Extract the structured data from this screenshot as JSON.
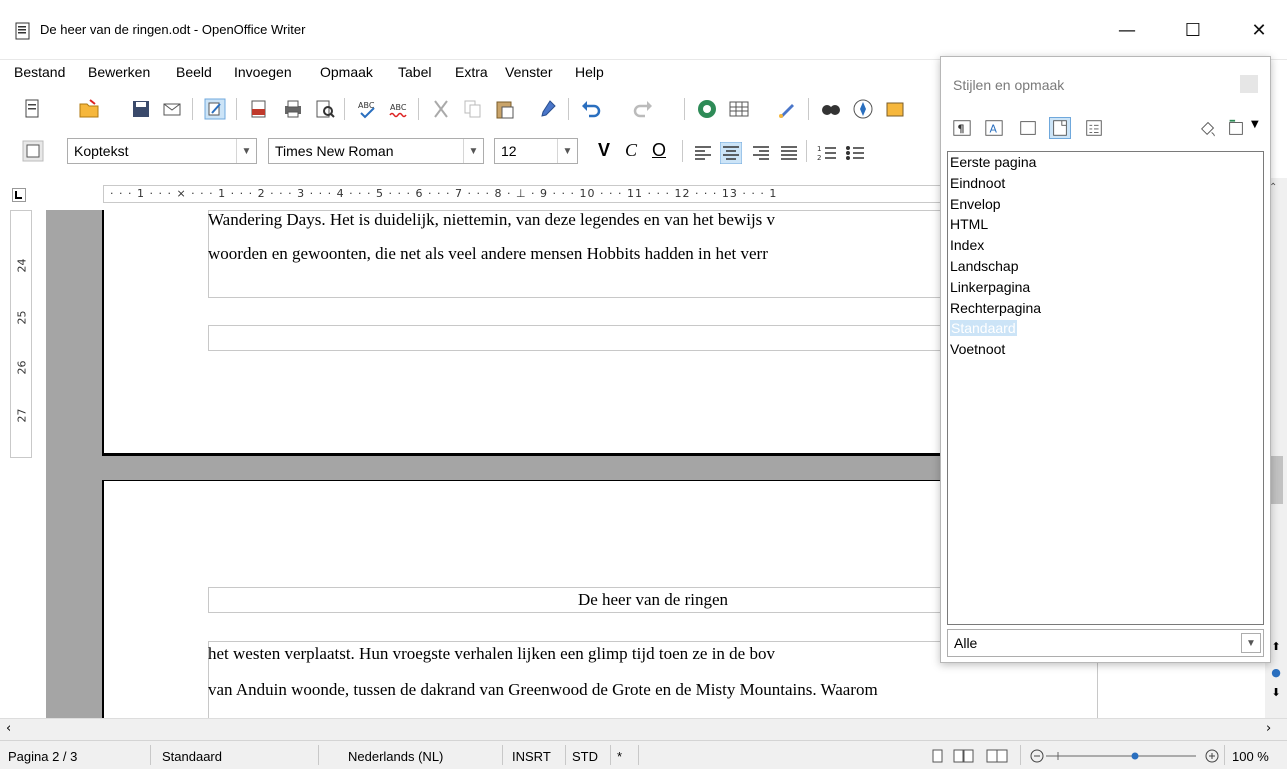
{
  "window": {
    "title": "De heer van de ringen.odt - OpenOffice Writer"
  },
  "menu": [
    "Bestand",
    "Bewerken",
    "Beeld",
    "Invoegen",
    "Opmaak",
    "Tabel",
    "Extra",
    "Venster",
    "Help"
  ],
  "formatting": {
    "style": "Koptekst",
    "font": "Times New Roman",
    "size": "12",
    "bold_glyph": "V",
    "italic_glyph": "C",
    "underline_glyph": "O"
  },
  "ruler": {
    "top": "· · · 1 · · · ⨯ · · · 1 · · · 2 · · · 3 · · · 4 · · · 5 · · · 6 · · · 7 · · · 8 · ⊥ · 9 · · · 10 · · · 11 · · · 12 · · · 13 · · · 1",
    "left": [
      "24",
      "25",
      "26",
      "27"
    ]
  },
  "document": {
    "line1": "Wandering Days. Het is duidelijk, niettemin, van deze legendes en van het bewijs v",
    "line2": "woorden en gewoonten, die net als veel andere mensen Hobbits hadden in het verr",
    "header": "De heer van de ringen",
    "line3": "het westen verplaatst. Hun vroegste verhalen lijken een glimp tijd toen ze in de bov",
    "line4": "van Anduin woonde, tussen de dakrand van Greenwood de Grote en de Misty Mountains. Waarom"
  },
  "styles_panel": {
    "title": "Stijlen en opmaak",
    "items": [
      "Eerste pagina",
      "Eindnoot",
      "Envelop",
      "HTML",
      "Index",
      "Landschap",
      "Linkerpagina",
      "Rechterpagina",
      "Standaard",
      "Voetnoot"
    ],
    "selected": "Standaard",
    "filter": "Alle"
  },
  "status": {
    "page": "Pagina 2 / 3",
    "style": "Standaard",
    "language": "Nederlands (NL)",
    "insert": "INSRT",
    "selection": "STD",
    "modified": "*",
    "zoom": "100 %"
  },
  "colors": {
    "selection": "#cce4f7",
    "page_bg": "#a5a5a5"
  }
}
